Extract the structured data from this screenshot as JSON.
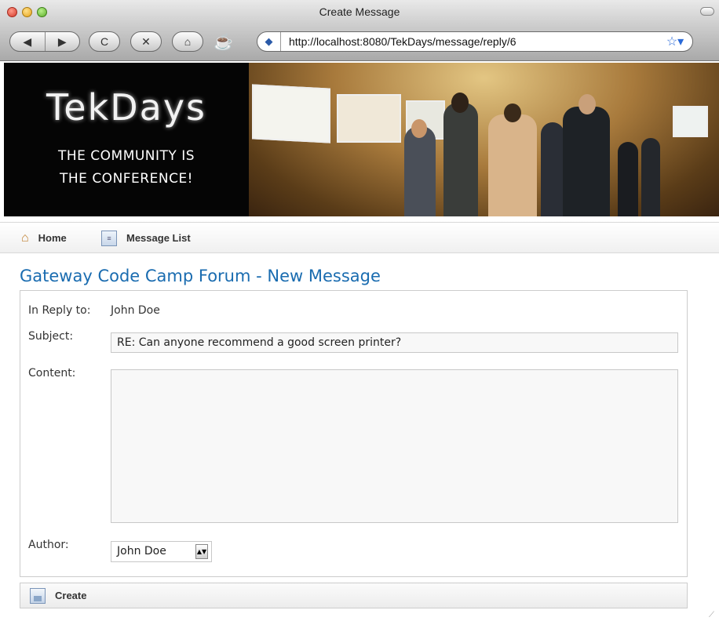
{
  "window": {
    "title": "Create Message"
  },
  "toolbar": {
    "back_icon": "◀",
    "forward_icon": "▶",
    "reload_icon": "C",
    "stop_icon": "✕",
    "home_icon": "⌂",
    "url": "http://localhost:8080/TekDays/message/reply/6"
  },
  "banner": {
    "logo": "TekDays",
    "tagline_line1": "THE COMMUNITY IS",
    "tagline_line2": "THE CONFERENCE!"
  },
  "nav": {
    "home_label": "Home",
    "message_list_label": "Message List"
  },
  "page": {
    "title": "Gateway Code Camp Forum - New Message"
  },
  "form": {
    "in_reply_to_label": "In Reply to:",
    "in_reply_to_value": "John Doe",
    "subject_label": "Subject:",
    "subject_value": "RE: Can anyone recommend a good screen printer?",
    "content_label": "Content:",
    "content_value": "",
    "author_label": "Author:",
    "author_selected": "John Doe"
  },
  "buttons": {
    "create_label": "Create"
  },
  "colors": {
    "title_blue": "#1a6cb0",
    "banner_black": "#050505"
  }
}
